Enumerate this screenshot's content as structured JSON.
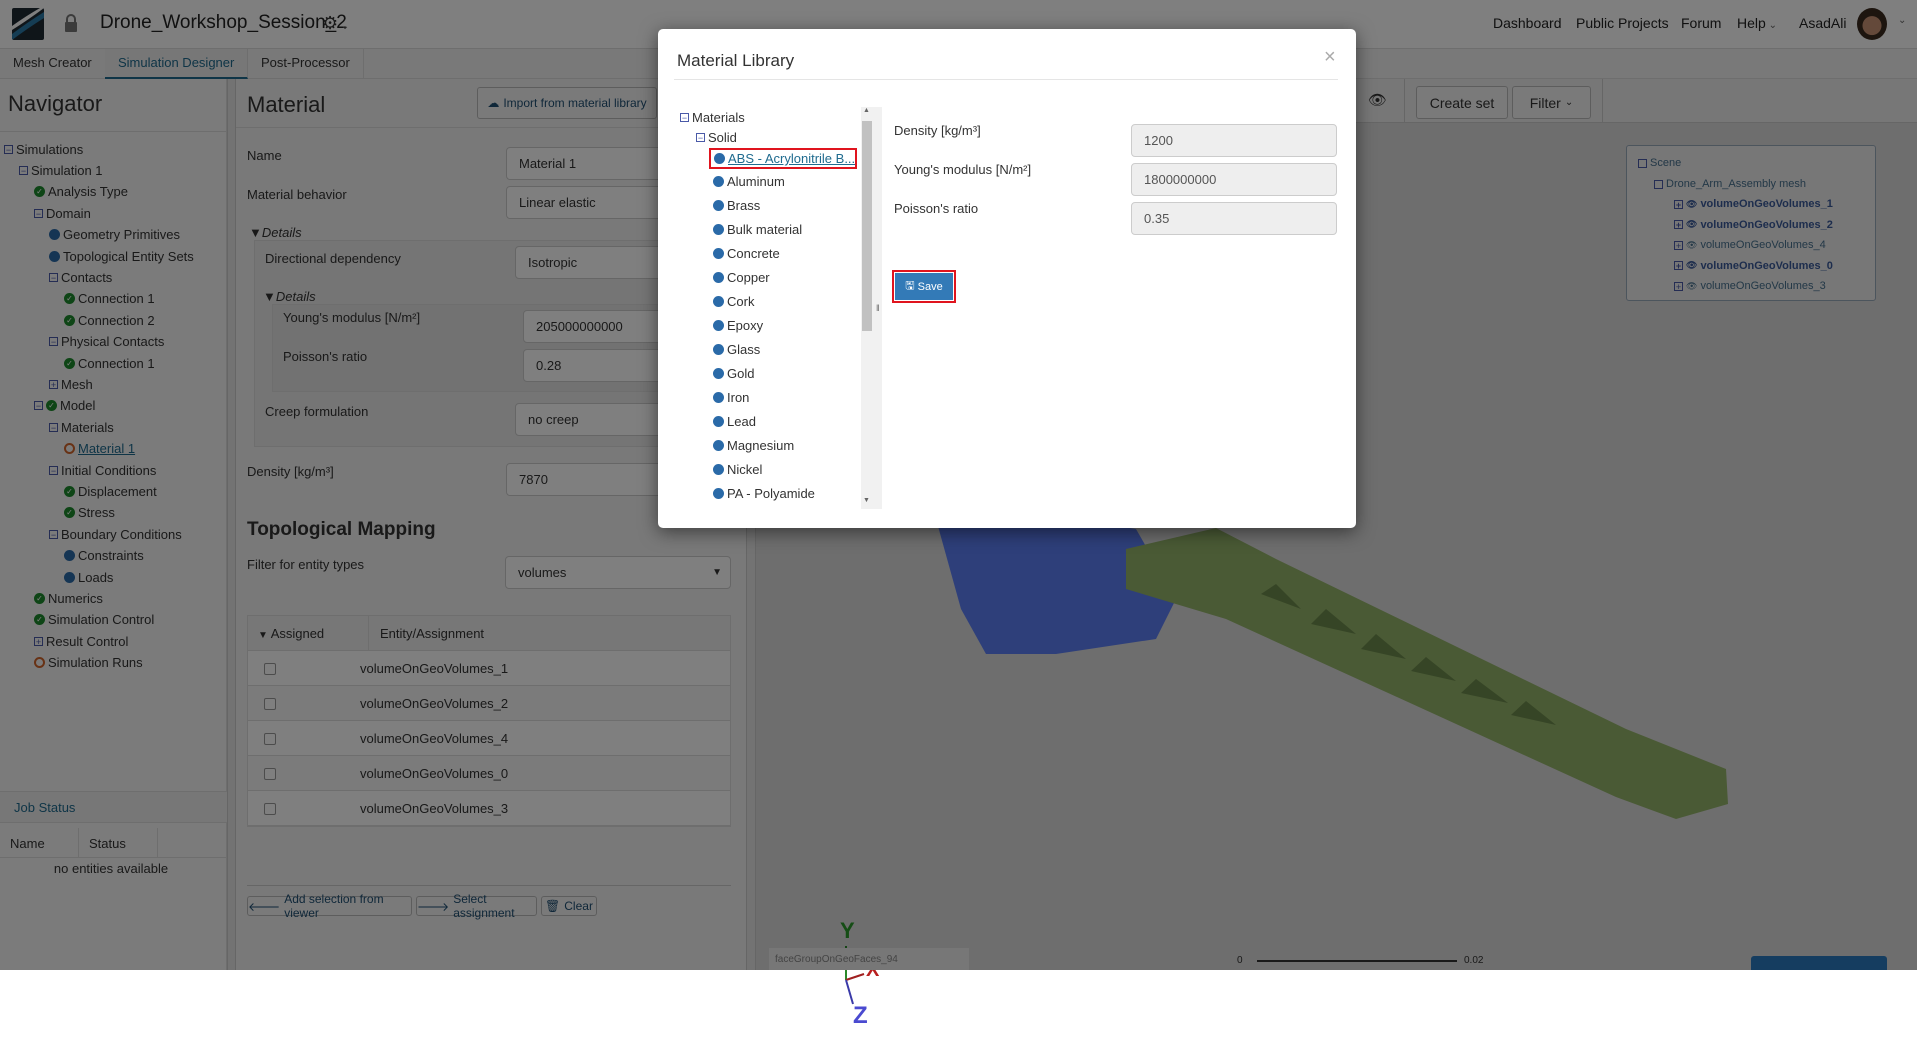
{
  "header": {
    "project_title": "Drone_Workshop_Session_2",
    "nav_links": [
      "Dashboard",
      "Public Projects",
      "Forum",
      "Help"
    ],
    "user": "AsadAli"
  },
  "tabs": [
    "Mesh Creator",
    "Simulation Designer",
    "Post-Processor"
  ],
  "active_tab": "Simulation Designer",
  "navigator": {
    "title": "Navigator",
    "tree": [
      {
        "label": "Simulations",
        "level": 0,
        "icon": "minus"
      },
      {
        "label": "Simulation 1",
        "level": 1,
        "icon": "minus"
      },
      {
        "label": "Analysis Type",
        "level": 2,
        "icon": "check"
      },
      {
        "label": "Domain",
        "level": 2,
        "icon": "minus"
      },
      {
        "label": "Geometry Primitives",
        "level": 3,
        "icon": "dot"
      },
      {
        "label": "Topological Entity Sets",
        "level": 3,
        "icon": "dot"
      },
      {
        "label": "Contacts",
        "level": 3,
        "icon": "minus"
      },
      {
        "label": "Connection 1",
        "level": 4,
        "icon": "check"
      },
      {
        "label": "Connection 2",
        "level": 4,
        "icon": "check"
      },
      {
        "label": "Physical Contacts",
        "level": 3,
        "icon": "minus"
      },
      {
        "label": "Connection 1",
        "level": 4,
        "icon": "check"
      },
      {
        "label": "Mesh",
        "level": 3,
        "icon": "plus"
      },
      {
        "label": "Model",
        "level": 2,
        "icon": "minus-check"
      },
      {
        "label": "Materials",
        "level": 3,
        "icon": "minus"
      },
      {
        "label": "Material 1",
        "level": 4,
        "icon": "ring",
        "selected": true
      },
      {
        "label": "Initial Conditions",
        "level": 3,
        "icon": "minus"
      },
      {
        "label": "Displacement",
        "level": 4,
        "icon": "check"
      },
      {
        "label": "Stress",
        "level": 4,
        "icon": "check"
      },
      {
        "label": "Boundary Conditions",
        "level": 3,
        "icon": "minus"
      },
      {
        "label": "Constraints",
        "level": 4,
        "icon": "dot"
      },
      {
        "label": "Loads",
        "level": 4,
        "icon": "dot"
      },
      {
        "label": "Numerics",
        "level": 2,
        "icon": "check"
      },
      {
        "label": "Simulation Control",
        "level": 2,
        "icon": "check"
      },
      {
        "label": "Result Control",
        "level": 2,
        "icon": "plus"
      },
      {
        "label": "Simulation Runs",
        "level": 2,
        "icon": "ring"
      }
    ]
  },
  "job_status": {
    "title": "Job Status",
    "columns": [
      "Name",
      "Status"
    ],
    "empty_text": "no entities available"
  },
  "material_panel": {
    "title": "Material",
    "import_button": "Import from material library",
    "name_label": "Name",
    "name_value": "Material 1",
    "behavior_label": "Material behavior",
    "behavior_value": "Linear elastic",
    "details_label": "Details",
    "directional_label": "Directional dependency",
    "directional_value": "Isotropic",
    "inner_details_label": "Details",
    "youngs_label": "Young's modulus [N/m²]",
    "youngs_value": "205000000000",
    "poisson_label": "Poisson's ratio",
    "poisson_value": "0.28",
    "creep_label": "Creep formulation",
    "creep_value": "no creep",
    "density_label": "Density [kg/m³]",
    "density_value": "7870"
  },
  "topological_mapping": {
    "title": "Topological Mapping",
    "filter_label": "Filter for entity types",
    "filter_value": "volumes",
    "columns": [
      "Assigned",
      "Entity/Assignment"
    ],
    "rows": [
      "volumeOnGeoVolumes_1",
      "volumeOnGeoVolumes_2",
      "volumeOnGeoVolumes_4",
      "volumeOnGeoVolumes_0",
      "volumeOnGeoVolumes_3"
    ],
    "buttons": {
      "add": "Add selection from viewer",
      "select": "Select assignment",
      "clear": "Clear"
    }
  },
  "viewer": {
    "create_set": "Create set",
    "filter": "Filter",
    "scene_tree": {
      "root": "Scene",
      "mesh": "Drone_Arm_Assembly mesh",
      "items": [
        {
          "label": "volumeOnGeoVolumes_1",
          "bold": true
        },
        {
          "label": "volumeOnGeoVolumes_2",
          "bold": true
        },
        {
          "label": "volumeOnGeoVolumes_4",
          "bold": false
        },
        {
          "label": "volumeOnGeoVolumes_0",
          "bold": true
        },
        {
          "label": "volumeOnGeoVolumes_3",
          "bold": false
        }
      ]
    },
    "axes": {
      "x": "X",
      "y": "Y",
      "z": "Z"
    },
    "hover_label": "faceGroupOnGeoFaces_94",
    "scale": {
      "min": "0",
      "max": "0.02"
    },
    "colors": {
      "part_blue": "#5c7ef4",
      "part_green": "#94b46a"
    }
  },
  "modal": {
    "title": "Material Library",
    "tree_root": "Materials",
    "tree_group": "Solid",
    "materials": [
      "ABS - Acrylonitrile B...",
      "Aluminum",
      "Brass",
      "Bulk material",
      "Concrete",
      "Copper",
      "Cork",
      "Epoxy",
      "Glass",
      "Gold",
      "Iron",
      "Lead",
      "Magnesium",
      "Nickel",
      "PA - Polyamide"
    ],
    "selected_index": 0,
    "properties": [
      {
        "label": "Density [kg/m³]",
        "value": "1200"
      },
      {
        "label": "Young's modulus [N/m²]",
        "value": "1800000000"
      },
      {
        "label": "Poisson's ratio",
        "value": "0.35"
      }
    ],
    "save_button": "Save",
    "highlight_color": "#e0141e"
  }
}
